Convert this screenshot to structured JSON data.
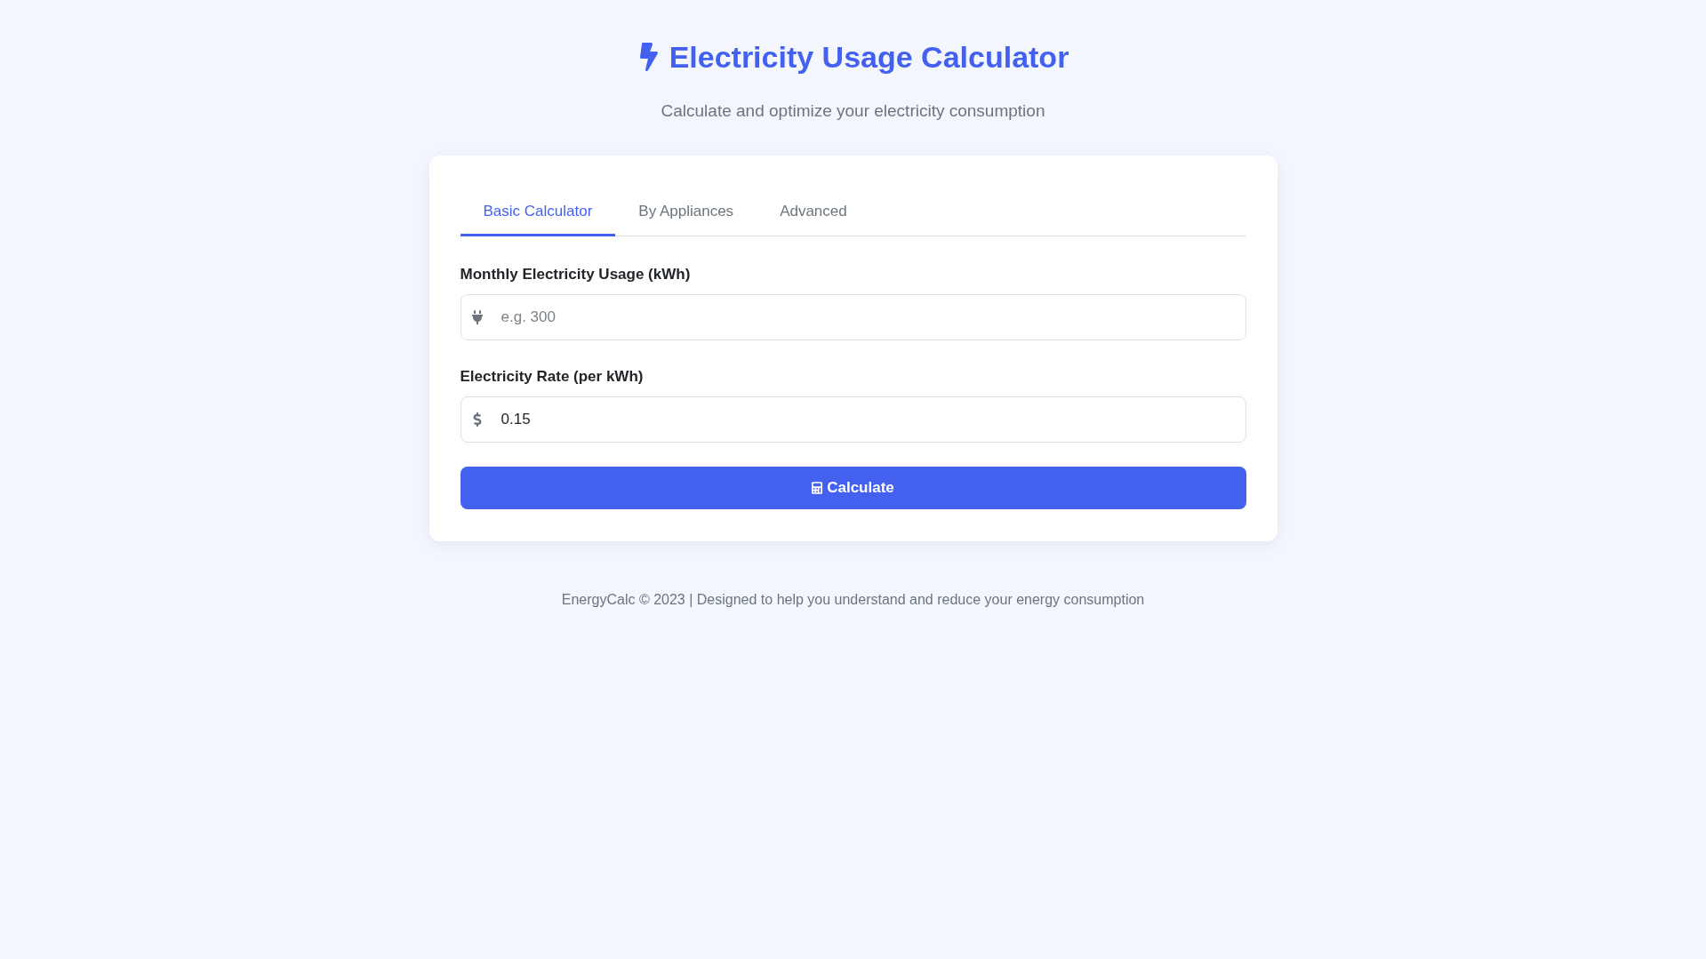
{
  "header": {
    "title": "Electricity Usage Calculator",
    "subtitle": "Calculate and optimize your electricity consumption"
  },
  "tabs": [
    {
      "label": "Basic Calculator",
      "selected": true
    },
    {
      "label": "By Appliances",
      "selected": false
    },
    {
      "label": "Advanced",
      "selected": false
    }
  ],
  "fields": [
    {
      "label": "Monthly Electricity Usage (kWh)",
      "placeholder": "e.g. 300"
    },
    {
      "label": "Electricity Rate (per kWh)",
      "value": "0.15"
    }
  ],
  "calculate_button": {
    "label": "Calculate"
  },
  "footer": "EnergyCalc © 2023 | Designed to help you understand and reduce your energy consumption"
}
